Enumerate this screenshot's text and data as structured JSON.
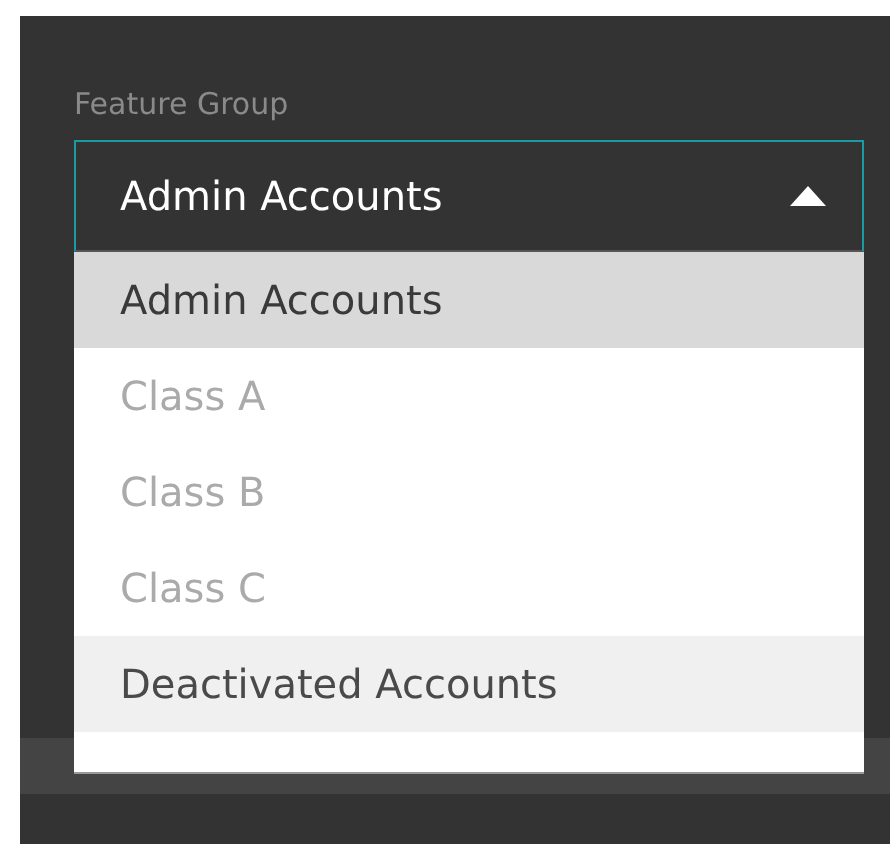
{
  "field": {
    "label": "Feature Group",
    "value": "Admin Accounts",
    "expanded": true
  },
  "options": [
    {
      "label": "Admin Accounts",
      "kind": "group",
      "selected": true
    },
    {
      "label": "Class A",
      "kind": "option",
      "selected": false
    },
    {
      "label": "Class B",
      "kind": "option",
      "selected": false
    },
    {
      "label": "Class C",
      "kind": "option",
      "selected": false
    },
    {
      "label": "Deactivated Accounts",
      "kind": "group",
      "selected": false
    }
  ]
}
